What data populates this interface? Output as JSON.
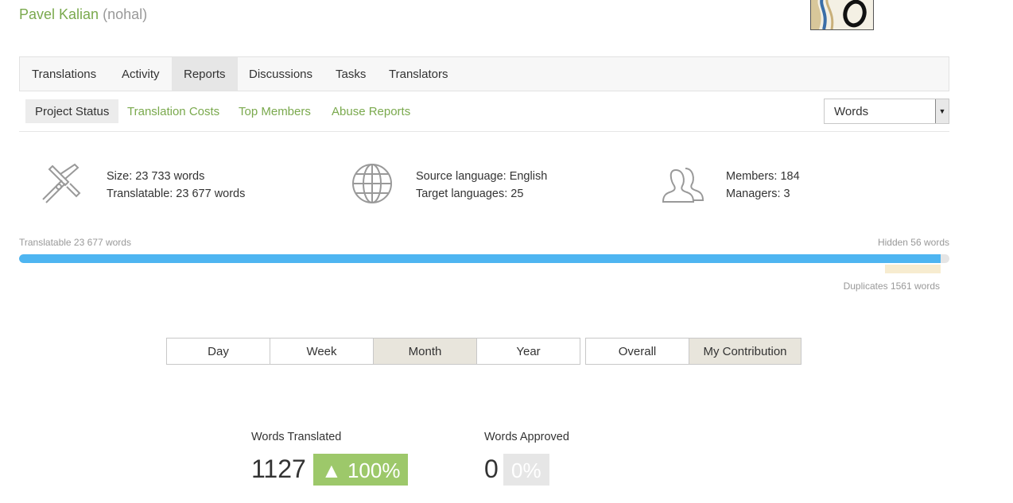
{
  "user": {
    "name": "Pavel Kalian",
    "handle": "(nohal)"
  },
  "tabs": [
    {
      "label": "Translations"
    },
    {
      "label": "Activity"
    },
    {
      "label": "Reports"
    },
    {
      "label": "Discussions"
    },
    {
      "label": "Tasks"
    },
    {
      "label": "Translators"
    }
  ],
  "subtabs": [
    {
      "label": "Project Status"
    },
    {
      "label": "Translation Costs"
    },
    {
      "label": "Top Members"
    },
    {
      "label": "Abuse Reports"
    }
  ],
  "unit_select": {
    "value": "Words"
  },
  "stats": {
    "size": "Size: 23 733 words",
    "translatable": "Translatable: 23 677 words",
    "source_language": "Source language: English",
    "target_languages": "Target languages: 25",
    "members": "Members: 184",
    "managers": "Managers: 3"
  },
  "progress": {
    "translatable_label": "Translatable 23 677 words",
    "hidden_label": "Hidden 56 words",
    "duplicates_label": "Duplicates 1561 words",
    "translatable_fraction": 0.9905,
    "duplicates_fraction": 0.06
  },
  "period_buttons": [
    {
      "label": "Day"
    },
    {
      "label": "Week"
    },
    {
      "label": "Month",
      "active": true
    },
    {
      "label": "Year"
    }
  ],
  "scope_buttons": [
    {
      "label": "Overall"
    },
    {
      "label": "My Contribution",
      "active": true
    }
  ],
  "metrics": {
    "translated": {
      "label": "Words Translated",
      "value": "1127",
      "change": "▲ 100%"
    },
    "approved": {
      "label": "Words Approved",
      "value": "0",
      "change": "0%"
    }
  },
  "colors": {
    "accent_green": "#7aa94d",
    "progress_blue": "#4eb5f1",
    "badge_green": "#9dc86a",
    "duplicates": "#f7ecd0"
  }
}
